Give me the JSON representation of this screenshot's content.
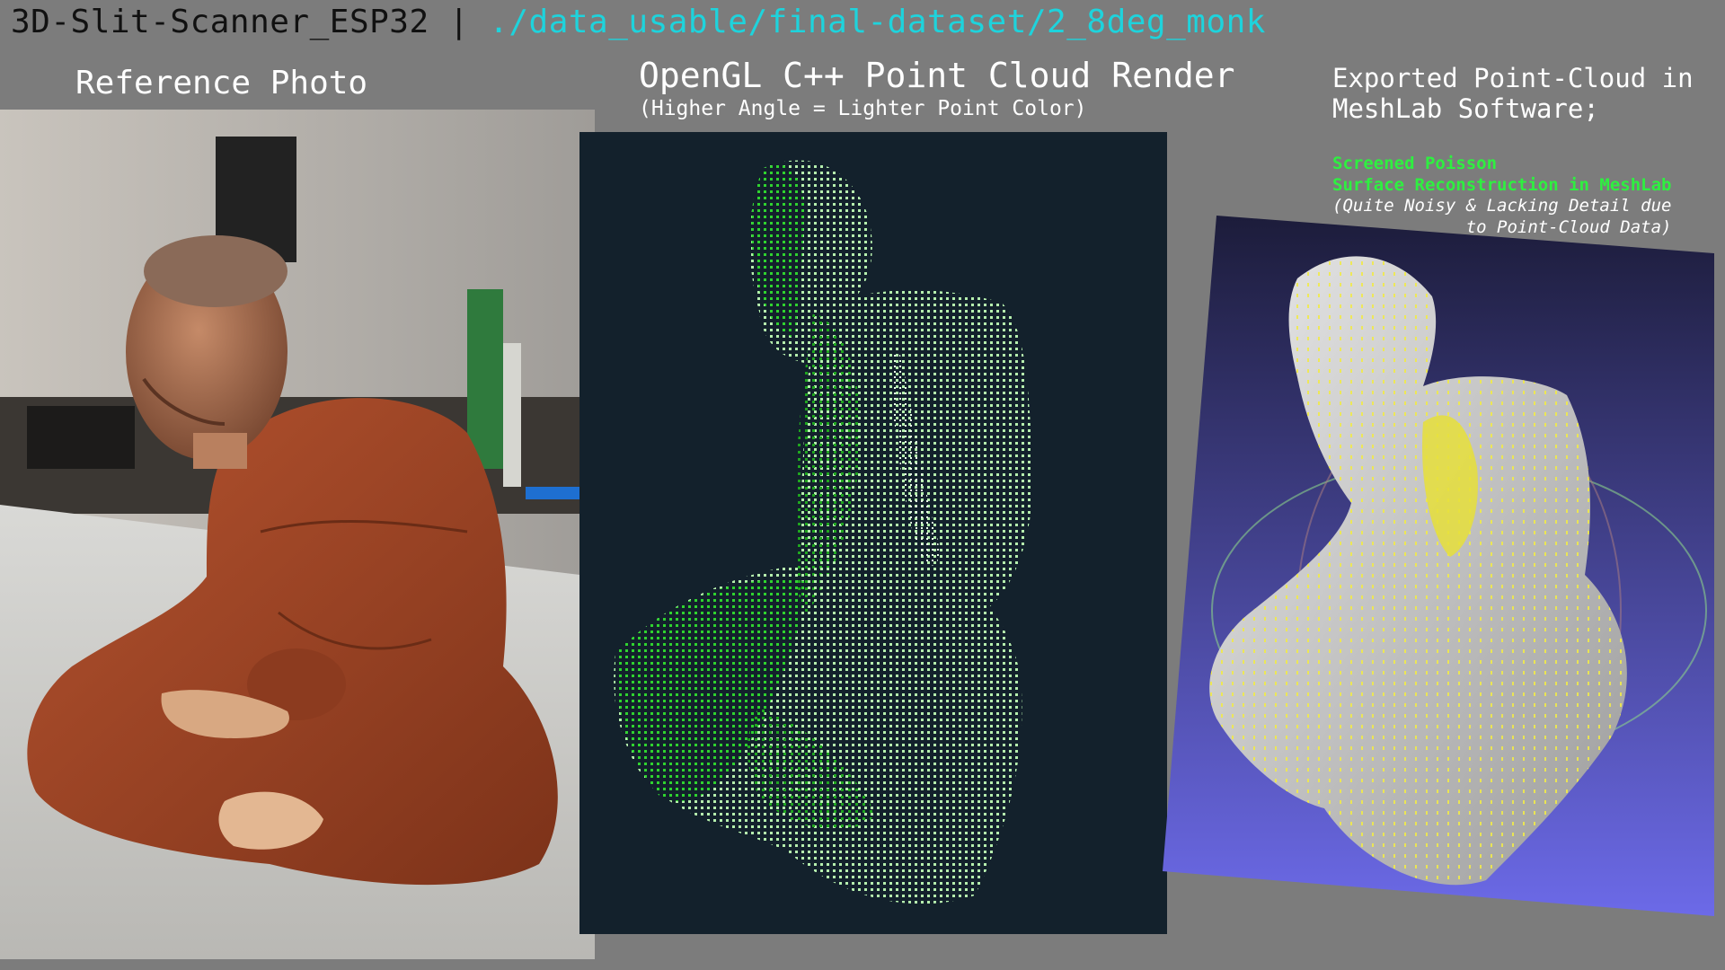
{
  "header": {
    "project": "3D-Slit-Scanner_ESP32",
    "separator": " | ",
    "path": "./data_usable/final-dataset/2_8deg_monk"
  },
  "reference": {
    "title": "Reference Photo"
  },
  "point_cloud": {
    "title": "OpenGL C++ Point Cloud Render",
    "subtitle": "(Higher Angle = Lighter Point Color)"
  },
  "meshlab": {
    "title_line1": "Exported Point-Cloud in",
    "title_line2": "MeshLab Software;",
    "green_line1": "Screened Poisson",
    "green_line2": "Surface Reconstruction in MeshLab",
    "note_line1": "(Quite Noisy & Lacking Detail due",
    "note_line2": "to Point-Cloud Data)"
  },
  "colors": {
    "background": "#7c7c7c",
    "path_accent": "#1ed3dc",
    "green_note": "#2ef040",
    "pointcloud_bg": "#13212c",
    "meshlab_gradient_top": "#1c1c3a",
    "meshlab_gradient_bottom": "#6c6ae8",
    "robe": "#a4482b"
  }
}
